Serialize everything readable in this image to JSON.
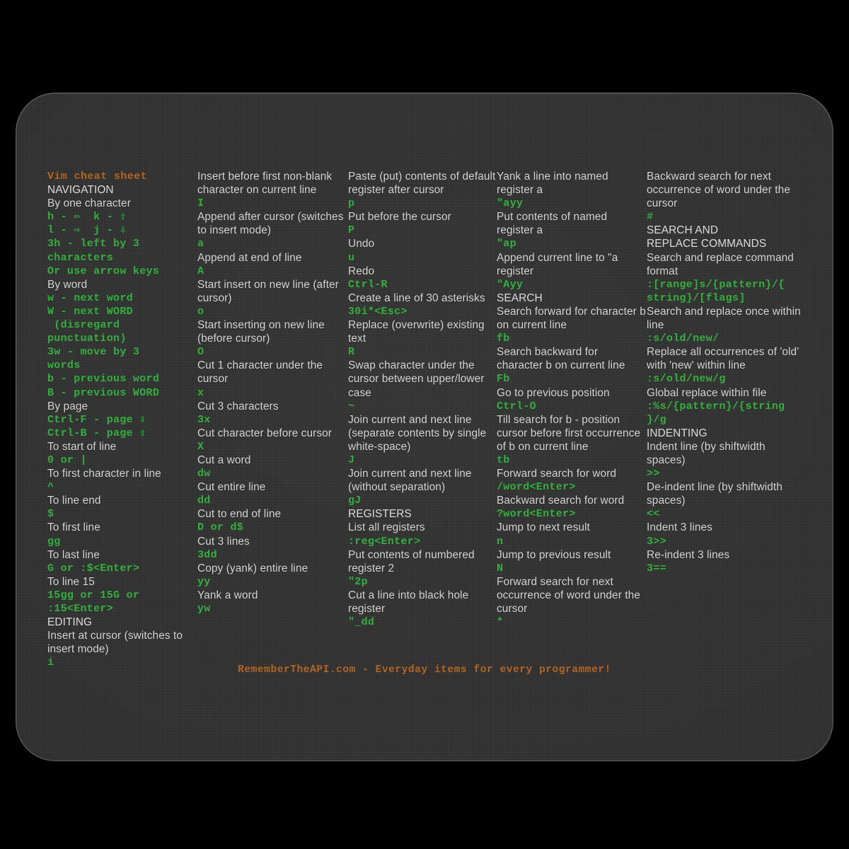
{
  "product": {
    "type": "mousepad",
    "title": "Vim cheat sheet",
    "accent_orange": "#b4641d",
    "command_green": "#2fb23a",
    "text_gray": "#d8d8d8",
    "pad_background": "#303030",
    "page_background": "#000000"
  },
  "footer": {
    "text": "RememberTheAPI.com - Everyday items for every programmer!"
  },
  "columns": [
    {
      "id": "column-1",
      "lines": [
        {
          "kind": "title",
          "text": "Vim cheat sheet"
        },
        {
          "kind": "sect",
          "text": "NAVIGATION"
        },
        {
          "kind": "desc",
          "text": "By one character"
        },
        {
          "kind": "cmd",
          "text": "h - ⇦  k - ⇧"
        },
        {
          "kind": "cmd",
          "text": "l - ⇨  j - ⇩"
        },
        {
          "kind": "cmd",
          "text": "3h - left by 3"
        },
        {
          "kind": "cmd",
          "text": "characters"
        },
        {
          "kind": "cmd",
          "text": "Or use arrow keys"
        },
        {
          "kind": "desc",
          "text": "By word"
        },
        {
          "kind": "cmd",
          "text": "w - next word"
        },
        {
          "kind": "cmd",
          "text": "W - next WORD"
        },
        {
          "kind": "cmd",
          "text": " (disregard"
        },
        {
          "kind": "cmd",
          "text": "punctuation)"
        },
        {
          "kind": "cmd",
          "text": "3w - move by 3"
        },
        {
          "kind": "cmd",
          "text": "words"
        },
        {
          "kind": "cmd",
          "text": "b - previous word"
        },
        {
          "kind": "cmd",
          "text": "B - previous WORD"
        },
        {
          "kind": "desc",
          "text": "By page"
        },
        {
          "kind": "cmd",
          "text": "Ctrl-F - page ⇩"
        },
        {
          "kind": "cmd",
          "text": "Ctrl-B - page ⇧"
        },
        {
          "kind": "desc",
          "text": "To start of line"
        },
        {
          "kind": "cmd",
          "text": "0 or |"
        },
        {
          "kind": "desc",
          "text": "To first character in line"
        },
        {
          "kind": "cmd",
          "text": "^"
        },
        {
          "kind": "desc",
          "text": "To line end"
        },
        {
          "kind": "cmd",
          "text": "$"
        },
        {
          "kind": "desc",
          "text": "To first line"
        },
        {
          "kind": "cmd",
          "text": "gg"
        },
        {
          "kind": "desc",
          "text": "To last line"
        },
        {
          "kind": "cmd",
          "text": "G or :$<Enter>"
        },
        {
          "kind": "desc",
          "text": "To line 15"
        },
        {
          "kind": "cmd",
          "text": "15gg or 15G or"
        },
        {
          "kind": "cmd",
          "text": ":15<Enter>"
        },
        {
          "kind": "sect",
          "text": "EDITING"
        },
        {
          "kind": "desc",
          "text": "Insert at cursor (switches to insert mode)"
        },
        {
          "kind": "cmd",
          "text": "i"
        }
      ]
    },
    {
      "id": "column-2",
      "lines": [
        {
          "kind": "desc",
          "text": "Insert before first non-blank character on current line"
        },
        {
          "kind": "cmd",
          "text": "I"
        },
        {
          "kind": "desc",
          "text": "Append after cursor (switches to insert mode)"
        },
        {
          "kind": "cmd",
          "text": "a"
        },
        {
          "kind": "desc",
          "text": "Append at end of line"
        },
        {
          "kind": "cmd",
          "text": "A"
        },
        {
          "kind": "desc",
          "text": "Start insert on new line (after cursor)"
        },
        {
          "kind": "cmd",
          "text": "o"
        },
        {
          "kind": "desc",
          "text": "Start inserting on new line (before cursor)"
        },
        {
          "kind": "cmd",
          "text": "O"
        },
        {
          "kind": "desc",
          "text": "Cut 1 character under the cursor"
        },
        {
          "kind": "cmd",
          "text": "x"
        },
        {
          "kind": "desc",
          "text": "Cut 3 characters"
        },
        {
          "kind": "cmd",
          "text": "3x"
        },
        {
          "kind": "desc",
          "text": "Cut character before cursor"
        },
        {
          "kind": "cmd",
          "text": "X"
        },
        {
          "kind": "desc",
          "text": "Cut a word"
        },
        {
          "kind": "cmd",
          "text": "dw"
        },
        {
          "kind": "desc",
          "text": "Cut entire line"
        },
        {
          "kind": "cmd",
          "text": "dd"
        },
        {
          "kind": "desc",
          "text": "Cut to end of line"
        },
        {
          "kind": "cmd",
          "text": "D or d$"
        },
        {
          "kind": "desc",
          "text": "Cut 3 lines"
        },
        {
          "kind": "cmd",
          "text": "3dd"
        },
        {
          "kind": "desc",
          "text": "Copy (yank) entire line"
        },
        {
          "kind": "cmd",
          "text": "yy"
        },
        {
          "kind": "desc",
          "text": "Yank a word"
        },
        {
          "kind": "cmd",
          "text": "yw"
        }
      ]
    },
    {
      "id": "column-3",
      "lines": [
        {
          "kind": "desc",
          "text": "Paste (put) contents of default register after cursor"
        },
        {
          "kind": "cmd",
          "text": "p"
        },
        {
          "kind": "desc",
          "text": "Put before the cursor"
        },
        {
          "kind": "cmd",
          "text": "P"
        },
        {
          "kind": "desc",
          "text": "Undo"
        },
        {
          "kind": "cmd",
          "text": "u"
        },
        {
          "kind": "desc",
          "text": "Redo"
        },
        {
          "kind": "cmd",
          "text": "Ctrl-R"
        },
        {
          "kind": "desc",
          "text": "Create a line of 30 asterisks"
        },
        {
          "kind": "cmd",
          "text": "30i*<Esc>"
        },
        {
          "kind": "desc",
          "text": "Replace (overwrite) existing text"
        },
        {
          "kind": "cmd",
          "text": "R"
        },
        {
          "kind": "desc",
          "text": "Swap character under the cursor between upper/lower case"
        },
        {
          "kind": "cmd",
          "text": "~"
        },
        {
          "kind": "desc",
          "text": "Join current and next line (separate contents by single white-space)"
        },
        {
          "kind": "cmd",
          "text": "J"
        },
        {
          "kind": "desc",
          "text": "Join current and next line (without separation)"
        },
        {
          "kind": "cmd",
          "text": "gJ"
        },
        {
          "kind": "sect",
          "text": "REGISTERS"
        },
        {
          "kind": "desc",
          "text": "List all registers"
        },
        {
          "kind": "cmd",
          "text": ":reg<Enter>"
        },
        {
          "kind": "desc",
          "text": "Put contents of numbered register 2"
        },
        {
          "kind": "cmd",
          "text": "\"2p"
        },
        {
          "kind": "desc",
          "text": "Cut a line into black hole register"
        },
        {
          "kind": "cmd",
          "text": "\"_dd"
        }
      ]
    },
    {
      "id": "column-4",
      "lines": [
        {
          "kind": "desc",
          "text": "Yank a line into named register a"
        },
        {
          "kind": "cmd",
          "text": "\"ayy"
        },
        {
          "kind": "desc",
          "text": "Put contents of named register a"
        },
        {
          "kind": "cmd",
          "text": "\"ap"
        },
        {
          "kind": "desc",
          "text": "Append current line to \"a register"
        },
        {
          "kind": "cmd",
          "text": "\"Ayy"
        },
        {
          "kind": "sect",
          "text": "SEARCH"
        },
        {
          "kind": "desc",
          "text": "Search forward for character b on current line"
        },
        {
          "kind": "cmd",
          "text": "fb"
        },
        {
          "kind": "desc",
          "text": "Search backward for character b on current line"
        },
        {
          "kind": "cmd",
          "text": "Fb"
        },
        {
          "kind": "desc",
          "text": "Go to previous position"
        },
        {
          "kind": "cmd",
          "text": "Ctrl-O"
        },
        {
          "kind": "desc",
          "text": "Till search for b - position cursor before first occurrence of b on current line"
        },
        {
          "kind": "cmd",
          "text": "tb"
        },
        {
          "kind": "desc",
          "text": "Forward search for word"
        },
        {
          "kind": "cmd",
          "text": "/word<Enter>"
        },
        {
          "kind": "desc",
          "text": "Backward search for word"
        },
        {
          "kind": "cmd",
          "text": "?word<Enter>"
        },
        {
          "kind": "desc",
          "text": "Jump to next result"
        },
        {
          "kind": "cmd",
          "text": "n"
        },
        {
          "kind": "desc",
          "text": "Jump to previous result"
        },
        {
          "kind": "cmd",
          "text": "N"
        },
        {
          "kind": "desc",
          "text": "Forward search for next occurrence of word under the cursor"
        },
        {
          "kind": "cmd",
          "text": "*"
        }
      ]
    },
    {
      "id": "column-5",
      "lines": [
        {
          "kind": "desc",
          "text": "Backward search for next occurrence of word under the cursor"
        },
        {
          "kind": "cmd",
          "text": "#"
        },
        {
          "kind": "sect",
          "text": "SEARCH AND"
        },
        {
          "kind": "sect",
          "text": "REPLACE COMMANDS"
        },
        {
          "kind": "desc",
          "text": "Search and replace command format"
        },
        {
          "kind": "cmd",
          "text": ":[range]s/{pattern}/{"
        },
        {
          "kind": "cmd",
          "text": "string}/[flags]"
        },
        {
          "kind": "desc",
          "text": "Search and replace once within line"
        },
        {
          "kind": "cmd",
          "text": ":s/old/new/"
        },
        {
          "kind": "desc",
          "text": "Replace all occurrences of 'old' with 'new' within line"
        },
        {
          "kind": "cmd",
          "text": ":s/old/new/g"
        },
        {
          "kind": "desc",
          "text": "Global replace within file"
        },
        {
          "kind": "cmd",
          "text": ":%s/{pattern}/{string"
        },
        {
          "kind": "cmd",
          "text": "}/g"
        },
        {
          "kind": "sect",
          "text": "INDENTING"
        },
        {
          "kind": "desc",
          "text": "Indent line (by shiftwidth spaces)"
        },
        {
          "kind": "cmd",
          "text": ">>"
        },
        {
          "kind": "desc",
          "text": "De-indent line (by shiftwidth spaces)"
        },
        {
          "kind": "cmd",
          "text": "<<"
        },
        {
          "kind": "desc",
          "text": "Indent 3 lines"
        },
        {
          "kind": "cmd",
          "text": "3>>"
        },
        {
          "kind": "desc",
          "text": "Re-indent 3 lines"
        },
        {
          "kind": "cmd",
          "text": "3=="
        }
      ]
    }
  ]
}
